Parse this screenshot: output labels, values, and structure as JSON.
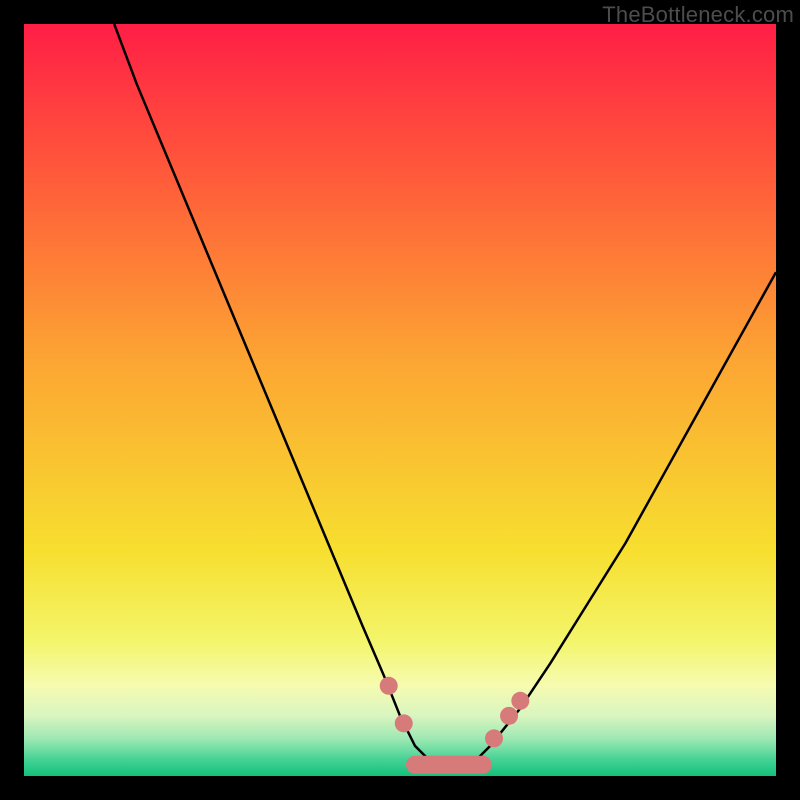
{
  "watermark": "TheBottleneck.com",
  "chart_data": {
    "type": "line",
    "title": "",
    "xlabel": "",
    "ylabel": "",
    "xlim": [
      0,
      100
    ],
    "ylim": [
      0,
      100
    ],
    "grid": false,
    "legend": false,
    "series": [
      {
        "name": "curve",
        "color": "#000000",
        "x": [
          12,
          15,
          20,
          25,
          30,
          35,
          40,
          45,
          48,
          50,
          52,
          54,
          56,
          58,
          60,
          62,
          66,
          70,
          75,
          80,
          85,
          90,
          95,
          100
        ],
        "values": [
          100,
          92,
          80,
          68,
          56,
          44,
          32,
          20,
          13,
          8,
          4,
          2,
          1,
          1,
          2,
          4,
          9,
          15,
          23,
          31,
          40,
          49,
          58,
          67
        ]
      }
    ],
    "markers": [
      {
        "name": "marker-left-1",
        "x": 48.5,
        "y": 12.0,
        "color": "#d77a7a",
        "r": 9
      },
      {
        "name": "marker-left-2",
        "x": 50.5,
        "y": 7.0,
        "color": "#d77a7a",
        "r": 9
      },
      {
        "name": "marker-right-1",
        "x": 62.5,
        "y": 5.0,
        "color": "#d77a7a",
        "r": 9
      },
      {
        "name": "marker-right-2",
        "x": 64.5,
        "y": 8.0,
        "color": "#d77a7a",
        "r": 9
      },
      {
        "name": "marker-right-3",
        "x": 66.0,
        "y": 10.0,
        "color": "#d77a7a",
        "r": 9
      }
    ],
    "base_band": {
      "name": "base-band",
      "x0": 52.0,
      "x1": 61.0,
      "y": 1.5,
      "thickness": 18,
      "color": "#d77a7a"
    },
    "gradient_stops": [
      {
        "offset": 0.0,
        "color": "#ff1e46"
      },
      {
        "offset": 0.2,
        "color": "#ff5a3a"
      },
      {
        "offset": 0.45,
        "color": "#fca633"
      },
      {
        "offset": 0.7,
        "color": "#f7df2f"
      },
      {
        "offset": 0.82,
        "color": "#f3f56a"
      },
      {
        "offset": 0.88,
        "color": "#f6fbb0"
      },
      {
        "offset": 0.92,
        "color": "#d9f5c0"
      },
      {
        "offset": 0.95,
        "color": "#9ee8b3"
      },
      {
        "offset": 0.98,
        "color": "#40d193"
      },
      {
        "offset": 1.0,
        "color": "#13c07a"
      }
    ]
  }
}
